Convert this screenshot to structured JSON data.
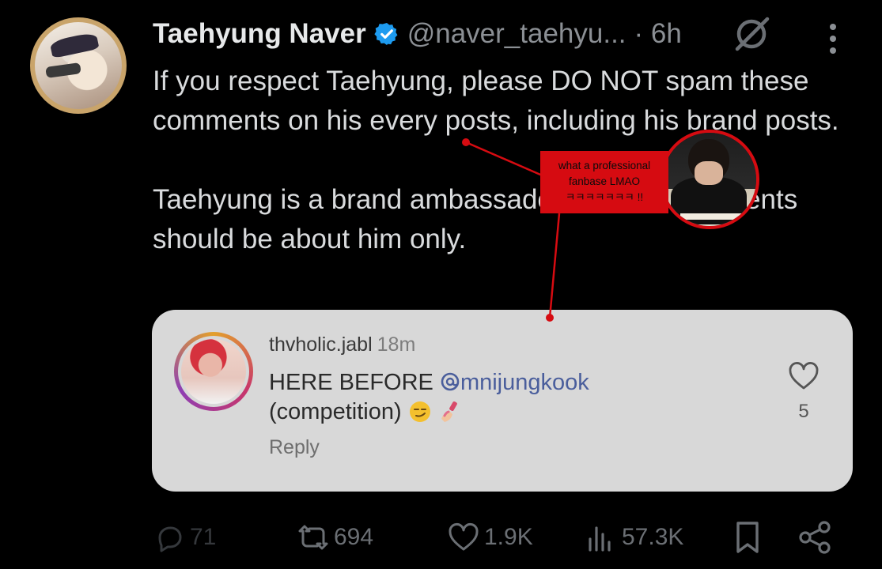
{
  "post": {
    "author_name": "Taehyung Naver",
    "author_handle": "@naver_taehyu...",
    "time": "· 6h",
    "text_paragraphs": [
      "If you respect Taehyung, please DO NOT spam these comments on his every posts, including his brand posts.",
      "Taehyung is a brand ambassador and the comments should be about him only."
    ]
  },
  "embedded_comment": {
    "username": "thvholic.jabl",
    "time": "18m",
    "text_before_mention": "HERE BEFORE ",
    "mention": "mnijungkook",
    "text_after": "(competition)",
    "reply_label": "Reply",
    "like_count": "5"
  },
  "actions": {
    "replies": "71",
    "reposts": "694",
    "likes": "1.9K",
    "views": "57.3K"
  },
  "annotation": {
    "line1": "what a professional",
    "line2": "fanbase LMAO",
    "line3": "ㅋㅋㅋㅋㅋㅋㅋ !!",
    "color": "#d60b11"
  },
  "colors": {
    "background": "#000000",
    "text_primary": "#e7e9ea",
    "text_secondary": "#8b8f94",
    "verified": "#1d9bf0",
    "card": "#d8d8d8"
  },
  "icons": [
    "verified-badge-icon",
    "grok-icon",
    "more-icon",
    "reply-icon",
    "repost-icon",
    "like-icon",
    "views-icon",
    "bookmark-icon",
    "share-icon",
    "comment-heart-icon",
    "threads-icon"
  ]
}
